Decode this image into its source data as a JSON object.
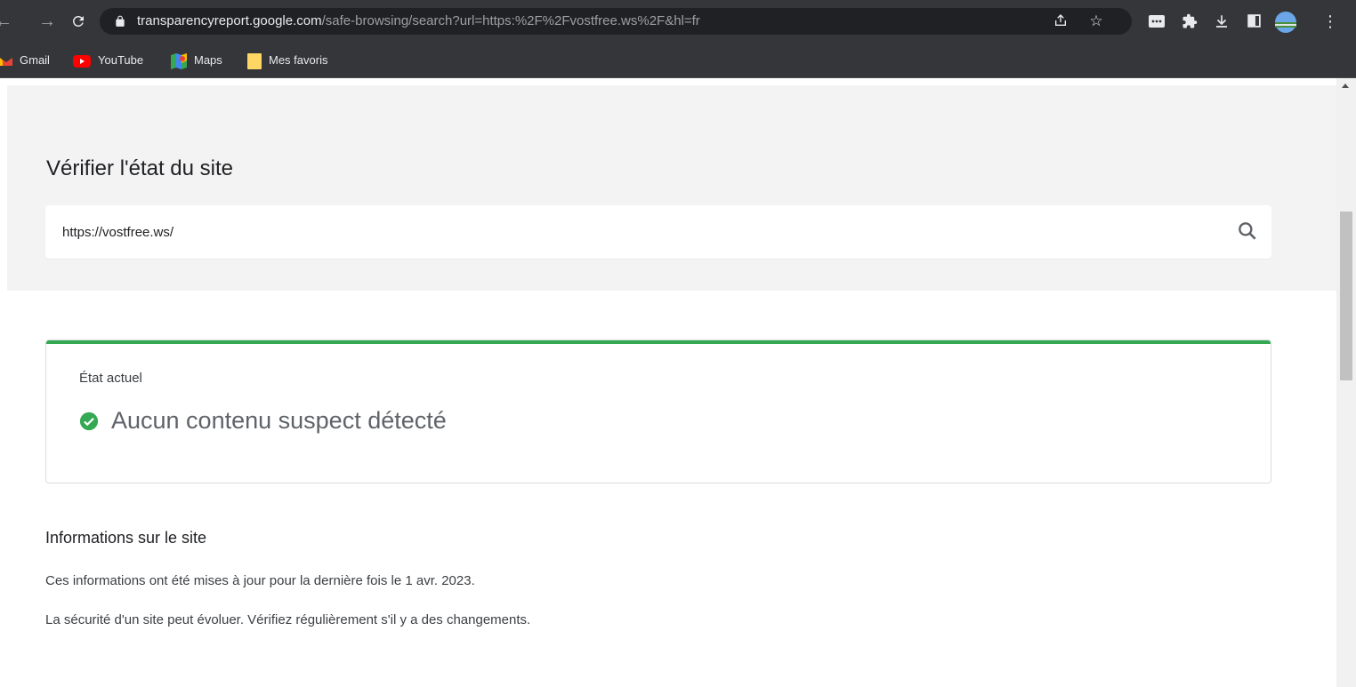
{
  "browser": {
    "url_host": "transparencyreport.google.com",
    "url_path": "/safe-browsing/search?url=https:%2F%2Fvostfree.ws%2F&hl=fr",
    "bookmarks": [
      {
        "label": "Gmail",
        "icon": "gmail-icon"
      },
      {
        "label": "YouTube",
        "icon": "youtube-icon"
      },
      {
        "label": "Maps",
        "icon": "maps-icon"
      },
      {
        "label": "Mes favoris",
        "icon": "folder-icon"
      }
    ]
  },
  "page": {
    "title": "Vérifier l'état du site",
    "search_value": "https://vostfree.ws/",
    "status_card": {
      "label": "État actuel",
      "status": "Aucun contenu suspect détecté",
      "status_color": "#34a853"
    },
    "info": {
      "title": "Informations sur le site",
      "updated": "Ces informations ont été mises à jour pour la dernière fois le 1 avr. 2023.",
      "note": "La sécurité d'un site peut évoluer. Vérifiez régulièrement s'il y a des changements."
    }
  }
}
